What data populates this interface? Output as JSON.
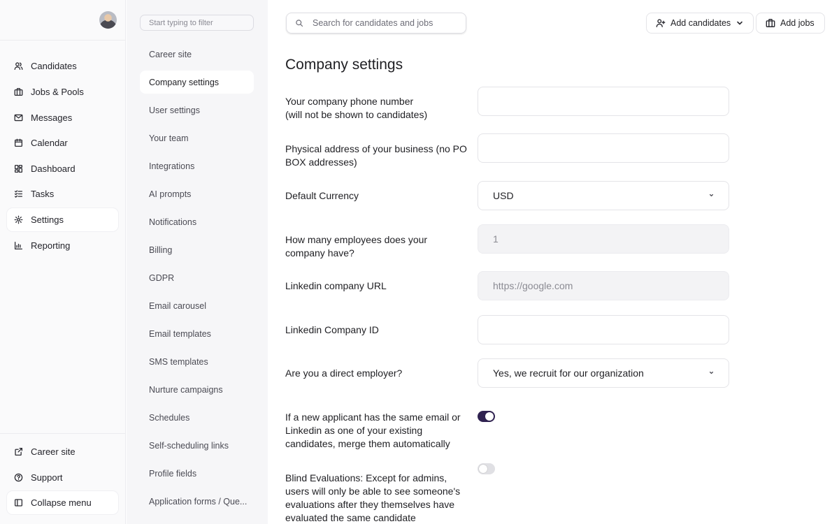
{
  "leftnav": {
    "items": [
      {
        "label": "Candidates",
        "icon": "users-icon"
      },
      {
        "label": "Jobs & Pools",
        "icon": "briefcase-icon"
      },
      {
        "label": "Messages",
        "icon": "mail-icon"
      },
      {
        "label": "Calendar",
        "icon": "calendar-icon"
      },
      {
        "label": "Dashboard",
        "icon": "dashboard-icon"
      },
      {
        "label": "Tasks",
        "icon": "checklist-icon"
      },
      {
        "label": "Settings",
        "icon": "gear-icon",
        "active": true
      },
      {
        "label": "Reporting",
        "icon": "chart-icon"
      }
    ],
    "bottom": [
      {
        "label": "Career site",
        "icon": "external-link-icon"
      },
      {
        "label": "Support",
        "icon": "help-icon"
      },
      {
        "label": "Collapse menu",
        "icon": "sidebar-collapse-icon"
      }
    ]
  },
  "subnav": {
    "filter_placeholder": "Start typing to filter",
    "items": [
      "Career site",
      "Company settings",
      "User settings",
      "Your team",
      "Integrations",
      "AI prompts",
      "Notifications",
      "Billing",
      "GDPR",
      "Email carousel",
      "Email templates",
      "SMS templates",
      "Nurture campaigns",
      "Schedules",
      "Self-scheduling links",
      "Profile fields",
      "Application forms / Que..."
    ],
    "active": "Company settings"
  },
  "header": {
    "search_placeholder": "Search for candidates and jobs",
    "add_candidates": "Add candidates",
    "add_jobs": "Add jobs"
  },
  "page": {
    "title": "Company settings",
    "fields": {
      "phone": {
        "label_line1": "Your company phone number",
        "label_line2": "(will not be shown to candidates)",
        "value": ""
      },
      "address": {
        "label": "Physical address of your business (no PO BOX addresses)",
        "value": ""
      },
      "currency": {
        "label": "Default Currency",
        "value": "USD"
      },
      "employees": {
        "label": "How many employees does your company have?",
        "placeholder": "1"
      },
      "linkedin_url": {
        "label": "Linkedin company URL",
        "placeholder": "https://google.com"
      },
      "linkedin_id": {
        "label": "Linkedin Company ID",
        "value": ""
      },
      "direct_employer": {
        "label": "Are you a direct employer?",
        "value": "Yes, we recruit for our organization"
      },
      "merge": {
        "label": "If a new applicant has the same email or Linkedin as one of your existing candidates, merge them automatically",
        "enabled": true
      },
      "blind": {
        "label": "Blind Evaluations: Except for admins, users will only be able to see someone's evaluations after they themselves have evaluated the same candidate",
        "enabled": false
      }
    }
  },
  "colors": {
    "toggle_on": "#2f2250",
    "toggle_off": "#e0e0e4",
    "sidebar_bg": "#fafafb",
    "subnav_bg": "#f6f6f8"
  }
}
